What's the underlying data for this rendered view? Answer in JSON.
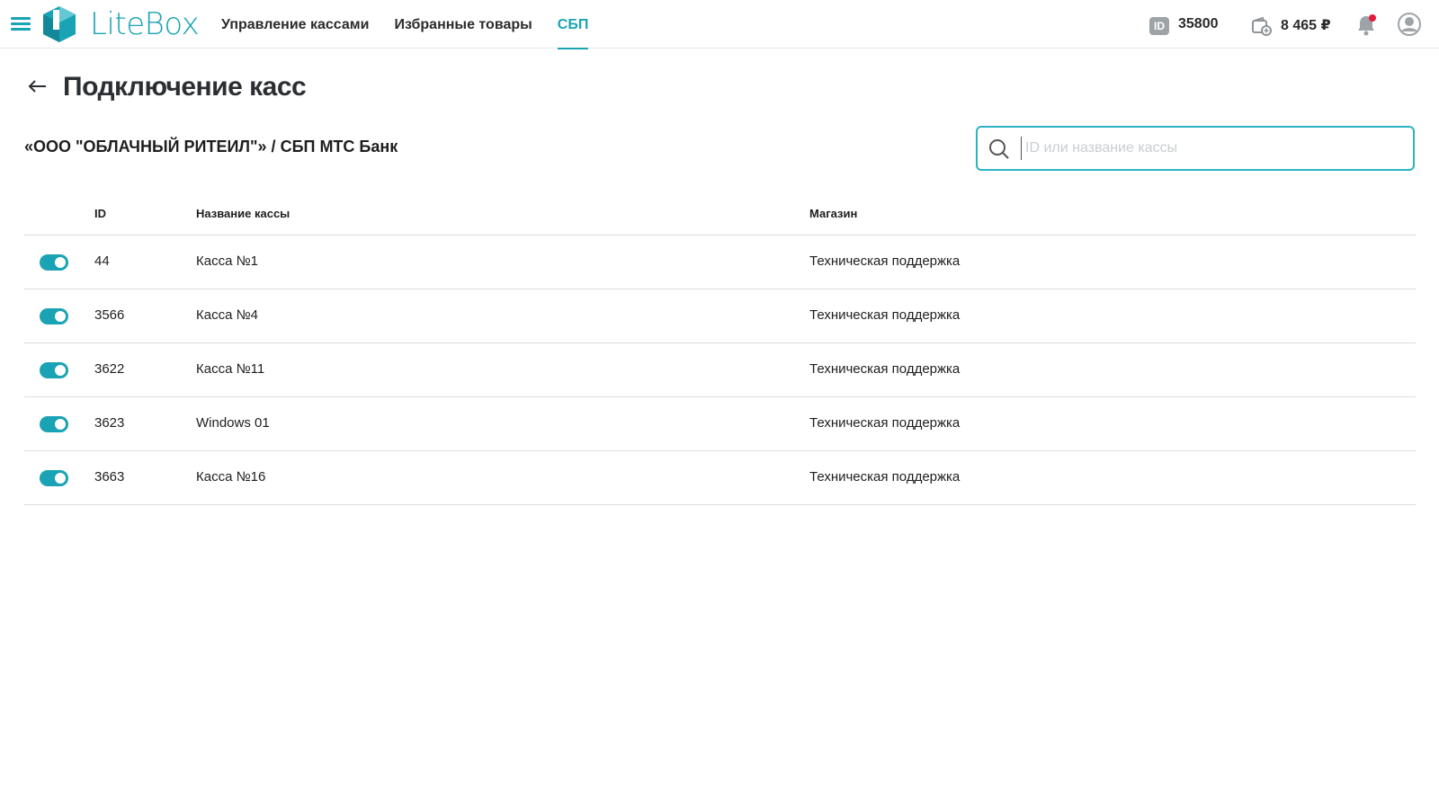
{
  "header": {
    "logo_text": "LiteBox",
    "nav": [
      {
        "label": "Управление кассами",
        "active": false
      },
      {
        "label": "Избранные товары",
        "active": false
      },
      {
        "label": "СБП",
        "active": true
      }
    ],
    "id_badge": "ID",
    "account_id": "35800",
    "balance": "8 465 ₽",
    "accent_color": "#1aa3b4",
    "notification_dot_color": "#e21b3c"
  },
  "page": {
    "title": "Подключение касс",
    "subtitle": "«ООО \"ОБЛАЧНЫЙ РИТЕИЛ\"» / СБП МТС Банк"
  },
  "search": {
    "value": "",
    "placeholder": "ID или название кассы"
  },
  "table": {
    "columns": [
      "ID",
      "Название кассы",
      "Магазин"
    ],
    "rows": [
      {
        "enabled": true,
        "id": "44",
        "name": "Касса №1",
        "store": "Техническая поддержка"
      },
      {
        "enabled": true,
        "id": "3566",
        "name": "Касса №4",
        "store": "Техническая поддержка"
      },
      {
        "enabled": true,
        "id": "3622",
        "name": "Касса №11",
        "store": "Техническая поддержка"
      },
      {
        "enabled": true,
        "id": "3623",
        "name": "Windows 01",
        "store": "Техническая поддержка"
      },
      {
        "enabled": true,
        "id": "3663",
        "name": "Касса №16",
        "store": "Техническая поддержка"
      }
    ]
  }
}
